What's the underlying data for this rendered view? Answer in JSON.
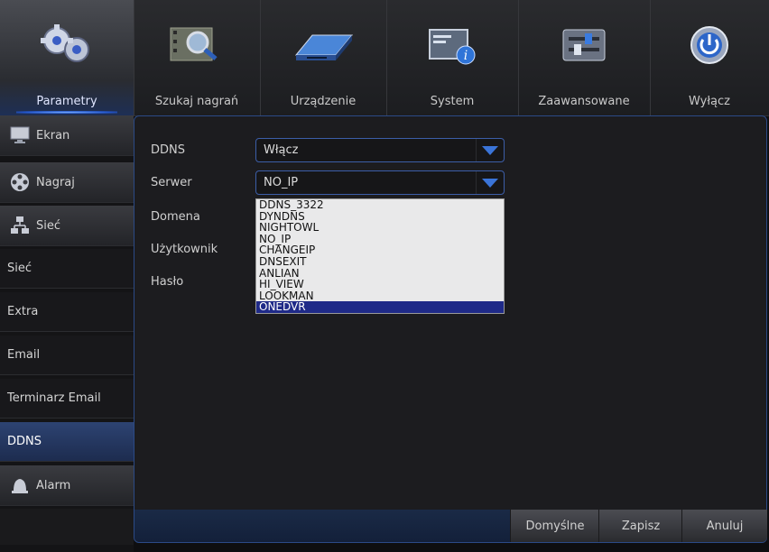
{
  "tabs": [
    {
      "label": "Parametry",
      "icon": "gears-icon",
      "active": true
    },
    {
      "label": "Szukaj nagrań",
      "icon": "film-search-icon",
      "active": false
    },
    {
      "label": "Urządzenie",
      "icon": "hard-drive-icon",
      "active": false
    },
    {
      "label": "System",
      "icon": "system-info-icon",
      "active": false
    },
    {
      "label": "Zaawansowane",
      "icon": "sliders-icon",
      "active": false
    },
    {
      "label": "Wyłącz",
      "icon": "power-icon",
      "active": false
    }
  ],
  "sidebar": {
    "items": [
      {
        "label": "Ekran",
        "icon": "monitor-icon",
        "type": "category"
      },
      {
        "label": "Nagraj",
        "icon": "film-reel-icon",
        "type": "category"
      },
      {
        "label": "Sieć",
        "icon": "network-icon",
        "type": "category"
      },
      {
        "label": "Sieć",
        "type": "sub"
      },
      {
        "label": "Extra",
        "type": "sub"
      },
      {
        "label": "Email",
        "type": "sub"
      },
      {
        "label": "Terminarz Email",
        "type": "sub"
      },
      {
        "label": "DDNS",
        "type": "sub",
        "active": true
      },
      {
        "label": "Alarm",
        "icon": "alarm-bell-icon",
        "type": "category"
      }
    ]
  },
  "form": {
    "ddns_label": "DDNS",
    "ddns_value": "Włącz",
    "server_label": "Serwer",
    "server_value": "NO_IP",
    "domain_label": "Domena",
    "user_label": "Użytkownik",
    "password_label": "Hasło"
  },
  "dropdown": {
    "options": [
      "DDNS_3322",
      "DYNDNS",
      "NIGHTOWL",
      "NO_IP",
      "CHANGEIP",
      "DNSEXIT",
      "ANLIAN",
      "HI_VIEW",
      "LOOKMAN",
      "ONEDVR"
    ],
    "highlighted": "ONEDVR"
  },
  "buttons": {
    "default": "Domyślne",
    "save": "Zapisz",
    "cancel": "Anuluj"
  },
  "colors": {
    "accent": "#3c5ea8",
    "highlight": "#1f2a88",
    "active_sidebar": "#2d4372"
  }
}
